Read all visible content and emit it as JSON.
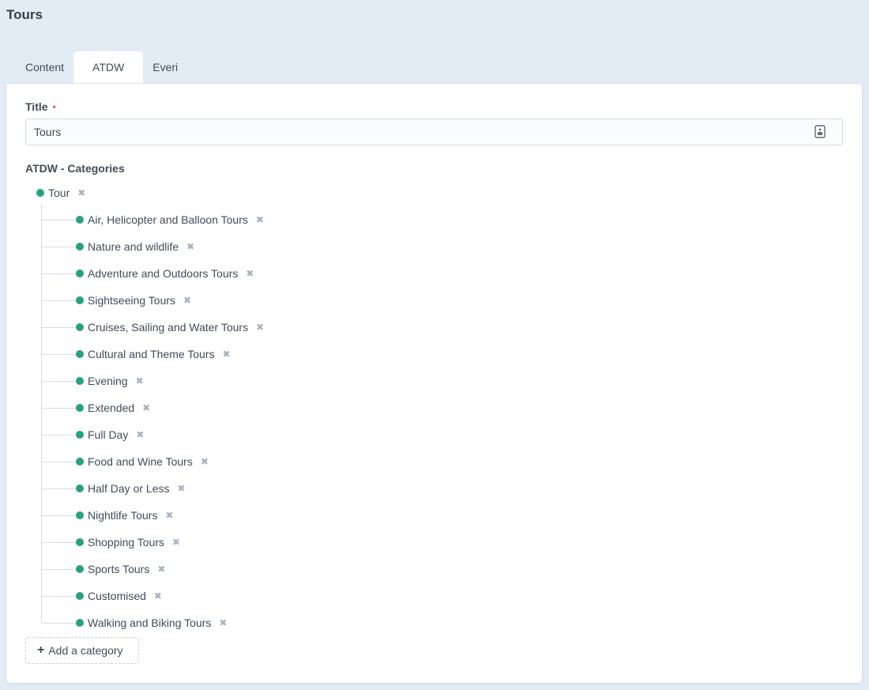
{
  "page": {
    "title": "Tours"
  },
  "tabs": [
    {
      "label": "Content",
      "active": false
    },
    {
      "label": "ATDW",
      "active": true
    },
    {
      "label": "Everi",
      "active": false
    }
  ],
  "form": {
    "title_label": "Title",
    "required_marker": "•",
    "title_value": "Tours",
    "categories_label": "ATDW - Categories",
    "add_category_label": "Add a category",
    "add_icon": "+",
    "remove_icon": "✖"
  },
  "categories": {
    "root": "Tour",
    "children": [
      "Air, Helicopter and Balloon Tours",
      "Nature and wildlife",
      "Adventure and Outdoors Tours",
      "Sightseeing Tours",
      "Cruises, Sailing and Water Tours",
      "Cultural and Theme Tours",
      "Evening",
      "Extended",
      "Full Day",
      "Food and Wine Tours",
      "Half Day or Less",
      "Nightlife Tours",
      "Shopping Tours",
      "Sports Tours",
      "Customised",
      "Walking and Biking Tours"
    ]
  },
  "colors": {
    "accent": "#27a27b",
    "background": "#e3ebf5",
    "required": "#e15d5d"
  }
}
